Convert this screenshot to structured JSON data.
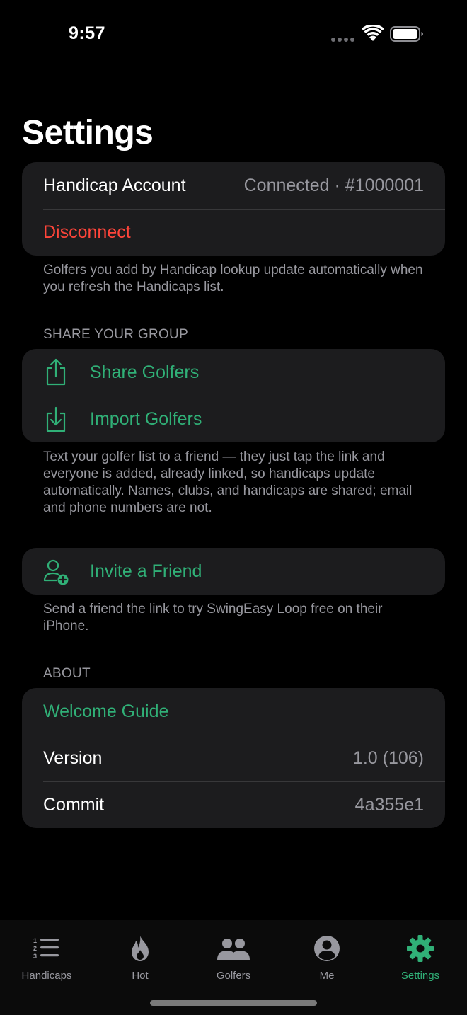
{
  "status_bar": {
    "time": "9:57"
  },
  "page_title": "Settings",
  "account": {
    "label": "Handicap Account",
    "value": "Connected · #1000001",
    "disconnect_label": "Disconnect",
    "footer": "Golfers you add by Handicap lookup update automatically when you refresh the Handicaps list."
  },
  "share": {
    "header": "SHARE YOUR GROUP",
    "share_label": "Share Golfers",
    "import_label": "Import Golfers",
    "footer": "Text your golfer list to a friend — they just tap the link and everyone is added, already linked, so handicaps update automatically. Names, clubs, and handicaps are shared; email and phone numbers are not."
  },
  "invite": {
    "label": "Invite a Friend",
    "footer": "Send a friend the link to try SwingEasy Loop free on their iPhone."
  },
  "about": {
    "header": "ABOUT",
    "welcome_label": "Welcome Guide",
    "version_label": "Version",
    "version_value": "1.0 (106)",
    "commit_label": "Commit",
    "commit_value": "4a355e1"
  },
  "tabs": [
    {
      "label": "Handicaps",
      "icon": "numbered-list-icon",
      "active": false
    },
    {
      "label": "Hot",
      "icon": "flame-icon",
      "active": false
    },
    {
      "label": "Golfers",
      "icon": "people-icon",
      "active": false
    },
    {
      "label": "Me",
      "icon": "person-circle-icon",
      "active": false
    },
    {
      "label": "Settings",
      "icon": "gear-icon",
      "active": true
    }
  ],
  "colors": {
    "accent": "#30b077",
    "destructive": "#ff453a",
    "background": "#000000",
    "group_background": "#1c1c1e",
    "secondary_text": "#98989f"
  }
}
